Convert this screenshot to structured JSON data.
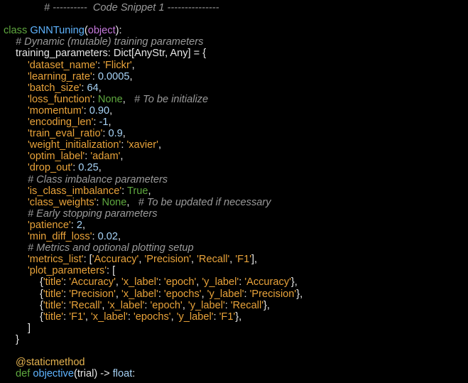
{
  "theme": {
    "background": "#000000",
    "comment": "#9a9a9a",
    "keyword": "#5fa83f",
    "string": "#e9a33a",
    "number": "#a6d2f5",
    "classname": "#5fb4ff",
    "builtin": "#c679dd",
    "plain": "#e6e6e6"
  },
  "code_lines": [
    [
      {
        "t": "comment",
        "v": "# ----------  Code Snippet 1 ---------------"
      }
    ],
    [],
    [
      {
        "t": "keyword",
        "v": "class "
      },
      {
        "t": "classname",
        "v": "GNNTuning"
      },
      {
        "t": "plain",
        "v": "("
      },
      {
        "t": "builtin",
        "v": "object"
      },
      {
        "t": "plain",
        "v": "):"
      }
    ],
    [
      {
        "t": "comment",
        "v": "# Dynamic (mutable) training parameters"
      }
    ],
    [
      {
        "t": "plain",
        "v": "training_parameters: Dict[AnyStr, Any] = {"
      }
    ],
    [
      {
        "t": "string",
        "v": "'dataset_name'"
      },
      {
        "t": "plain",
        "v": ": "
      },
      {
        "t": "string",
        "v": "'Flickr'"
      },
      {
        "t": "plain",
        "v": ","
      }
    ],
    [
      {
        "t": "string",
        "v": "'learning_rate'"
      },
      {
        "t": "plain",
        "v": ": "
      },
      {
        "t": "number",
        "v": "0.0005"
      },
      {
        "t": "plain",
        "v": ","
      }
    ],
    [
      {
        "t": "string",
        "v": "'batch_size'"
      },
      {
        "t": "plain",
        "v": ": "
      },
      {
        "t": "number",
        "v": "64"
      },
      {
        "t": "plain",
        "v": ","
      }
    ],
    [
      {
        "t": "string",
        "v": "'loss_function'"
      },
      {
        "t": "plain",
        "v": ": "
      },
      {
        "t": "const",
        "v": "None"
      },
      {
        "t": "plain",
        "v": ",   "
      },
      {
        "t": "comment",
        "v": "# To be initialize"
      }
    ],
    [
      {
        "t": "string",
        "v": "'momentum'"
      },
      {
        "t": "plain",
        "v": ": "
      },
      {
        "t": "number",
        "v": "0.90"
      },
      {
        "t": "plain",
        "v": ","
      }
    ],
    [
      {
        "t": "string",
        "v": "'encoding_len'"
      },
      {
        "t": "plain",
        "v": ": "
      },
      {
        "t": "number",
        "v": "-1"
      },
      {
        "t": "plain",
        "v": ","
      }
    ],
    [
      {
        "t": "string",
        "v": "'train_eval_ratio'"
      },
      {
        "t": "plain",
        "v": ": "
      },
      {
        "t": "number",
        "v": "0.9"
      },
      {
        "t": "plain",
        "v": ","
      }
    ],
    [
      {
        "t": "string",
        "v": "'weight_initialization'"
      },
      {
        "t": "plain",
        "v": ": "
      },
      {
        "t": "string",
        "v": "'xavier'"
      },
      {
        "t": "plain",
        "v": ","
      }
    ],
    [
      {
        "t": "string",
        "v": "'optim_label'"
      },
      {
        "t": "plain",
        "v": ": "
      },
      {
        "t": "string",
        "v": "'adam'"
      },
      {
        "t": "plain",
        "v": ","
      }
    ],
    [
      {
        "t": "string",
        "v": "'drop_out'"
      },
      {
        "t": "plain",
        "v": ": "
      },
      {
        "t": "number",
        "v": "0.25"
      },
      {
        "t": "plain",
        "v": ","
      }
    ],
    [
      {
        "t": "comment",
        "v": "# Class imbalance parameters"
      }
    ],
    [
      {
        "t": "string",
        "v": "'is_class_imbalance'"
      },
      {
        "t": "plain",
        "v": ": "
      },
      {
        "t": "const",
        "v": "True"
      },
      {
        "t": "plain",
        "v": ","
      }
    ],
    [
      {
        "t": "string",
        "v": "'class_weights'"
      },
      {
        "t": "plain",
        "v": ": "
      },
      {
        "t": "const",
        "v": "None"
      },
      {
        "t": "plain",
        "v": ",   "
      },
      {
        "t": "comment",
        "v": "# To be updated if necessary"
      }
    ],
    [
      {
        "t": "comment",
        "v": "# Early stopping parameters"
      }
    ],
    [
      {
        "t": "string",
        "v": "'patience'"
      },
      {
        "t": "plain",
        "v": ": "
      },
      {
        "t": "number",
        "v": "2"
      },
      {
        "t": "plain",
        "v": ","
      }
    ],
    [
      {
        "t": "string",
        "v": "'min_diff_loss'"
      },
      {
        "t": "plain",
        "v": ": "
      },
      {
        "t": "number",
        "v": "0.02"
      },
      {
        "t": "plain",
        "v": ","
      }
    ],
    [
      {
        "t": "comment",
        "v": "# Metrics and optional plotting setup"
      }
    ],
    [
      {
        "t": "string",
        "v": "'metrics_list'"
      },
      {
        "t": "plain",
        "v": ": ["
      },
      {
        "t": "string",
        "v": "'Accuracy'"
      },
      {
        "t": "plain",
        "v": ", "
      },
      {
        "t": "string",
        "v": "'Precision'"
      },
      {
        "t": "plain",
        "v": ", "
      },
      {
        "t": "string",
        "v": "'Recall'"
      },
      {
        "t": "plain",
        "v": ", "
      },
      {
        "t": "string",
        "v": "'F1'"
      },
      {
        "t": "plain",
        "v": "],"
      }
    ],
    [
      {
        "t": "string",
        "v": "'plot_parameters'"
      },
      {
        "t": "plain",
        "v": ": ["
      }
    ],
    [
      {
        "t": "plain",
        "v": "{"
      },
      {
        "t": "string",
        "v": "'title'"
      },
      {
        "t": "plain",
        "v": ": "
      },
      {
        "t": "string",
        "v": "'Accuracy'"
      },
      {
        "t": "plain",
        "v": ", "
      },
      {
        "t": "string",
        "v": "'x_label'"
      },
      {
        "t": "plain",
        "v": ": "
      },
      {
        "t": "string",
        "v": "'epoch'"
      },
      {
        "t": "plain",
        "v": ", "
      },
      {
        "t": "string",
        "v": "'y_label'"
      },
      {
        "t": "plain",
        "v": ": "
      },
      {
        "t": "string",
        "v": "'Accuracy'"
      },
      {
        "t": "plain",
        "v": "},"
      }
    ],
    [
      {
        "t": "plain",
        "v": "{"
      },
      {
        "t": "string",
        "v": "'title'"
      },
      {
        "t": "plain",
        "v": ": "
      },
      {
        "t": "string",
        "v": "'Precision'"
      },
      {
        "t": "plain",
        "v": ", "
      },
      {
        "t": "string",
        "v": "'x_label'"
      },
      {
        "t": "plain",
        "v": ": "
      },
      {
        "t": "string",
        "v": "'epochs'"
      },
      {
        "t": "plain",
        "v": ", "
      },
      {
        "t": "string",
        "v": "'y_label'"
      },
      {
        "t": "plain",
        "v": ": "
      },
      {
        "t": "string",
        "v": "'Precision'"
      },
      {
        "t": "plain",
        "v": "},"
      }
    ],
    [
      {
        "t": "plain",
        "v": "{"
      },
      {
        "t": "string",
        "v": "'title'"
      },
      {
        "t": "plain",
        "v": ": "
      },
      {
        "t": "string",
        "v": "'Recall'"
      },
      {
        "t": "plain",
        "v": ", "
      },
      {
        "t": "string",
        "v": "'x_label'"
      },
      {
        "t": "plain",
        "v": ": "
      },
      {
        "t": "string",
        "v": "'epoch'"
      },
      {
        "t": "plain",
        "v": ", "
      },
      {
        "t": "string",
        "v": "'y_label'"
      },
      {
        "t": "plain",
        "v": ": "
      },
      {
        "t": "string",
        "v": "'Recall'"
      },
      {
        "t": "plain",
        "v": "},"
      }
    ],
    [
      {
        "t": "plain",
        "v": "{"
      },
      {
        "t": "string",
        "v": "'title'"
      },
      {
        "t": "plain",
        "v": ": "
      },
      {
        "t": "string",
        "v": "'F1'"
      },
      {
        "t": "plain",
        "v": ", "
      },
      {
        "t": "string",
        "v": "'x_label'"
      },
      {
        "t": "plain",
        "v": ": "
      },
      {
        "t": "string",
        "v": "'epochs'"
      },
      {
        "t": "plain",
        "v": ", "
      },
      {
        "t": "string",
        "v": "'y_label'"
      },
      {
        "t": "plain",
        "v": ": "
      },
      {
        "t": "string",
        "v": "'F1'"
      },
      {
        "t": "plain",
        "v": "},"
      }
    ],
    [
      {
        "t": "plain",
        "v": "]"
      }
    ],
    [
      {
        "t": "plain",
        "v": "}"
      }
    ],
    [],
    [
      {
        "t": "decorator",
        "v": "@staticmethod"
      }
    ],
    [
      {
        "t": "keyword",
        "v": "def "
      },
      {
        "t": "func",
        "v": "objective"
      },
      {
        "t": "plain",
        "v": "(trial) -> "
      },
      {
        "t": "type",
        "v": "float"
      },
      {
        "t": "plain",
        "v": ":"
      }
    ]
  ]
}
